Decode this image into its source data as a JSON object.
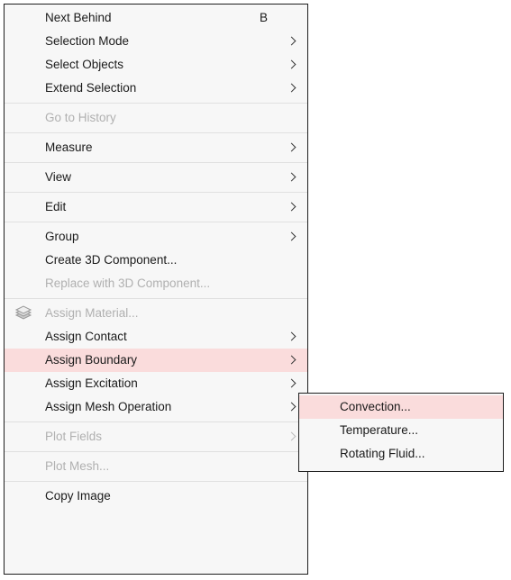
{
  "colors": {
    "menu_background": "#f7f7f7",
    "menu_border": "#1d1d1d",
    "highlight": "#fadcdc",
    "text": "#1a1a1a",
    "text_disabled": "#b0b0b0",
    "separator": "#e0e0e0"
  },
  "main_menu": {
    "items": [
      {
        "label": "Next Behind",
        "shortcut": "B",
        "submenu": false,
        "disabled": false,
        "highlighted": false,
        "icon": null
      },
      {
        "label": "Selection Mode",
        "shortcut": "",
        "submenu": true,
        "disabled": false,
        "highlighted": false,
        "icon": null
      },
      {
        "label": "Select Objects",
        "shortcut": "",
        "submenu": true,
        "disabled": false,
        "highlighted": false,
        "icon": null
      },
      {
        "label": "Extend Selection",
        "shortcut": "",
        "submenu": true,
        "disabled": false,
        "highlighted": false,
        "icon": null
      },
      {
        "separator": true
      },
      {
        "label": "Go to History",
        "shortcut": "",
        "submenu": false,
        "disabled": true,
        "highlighted": false,
        "icon": null
      },
      {
        "separator": true
      },
      {
        "label": "Measure",
        "shortcut": "",
        "submenu": true,
        "disabled": false,
        "highlighted": false,
        "icon": null
      },
      {
        "separator": true
      },
      {
        "label": "View",
        "shortcut": "",
        "submenu": true,
        "disabled": false,
        "highlighted": false,
        "icon": null
      },
      {
        "separator": true
      },
      {
        "label": "Edit",
        "shortcut": "",
        "submenu": true,
        "disabled": false,
        "highlighted": false,
        "icon": null
      },
      {
        "separator": true
      },
      {
        "label": "Group",
        "shortcut": "",
        "submenu": true,
        "disabled": false,
        "highlighted": false,
        "icon": null
      },
      {
        "label": "Create 3D Component...",
        "shortcut": "",
        "submenu": false,
        "disabled": false,
        "highlighted": false,
        "icon": null
      },
      {
        "label": "Replace with 3D Component...",
        "shortcut": "",
        "submenu": false,
        "disabled": true,
        "highlighted": false,
        "icon": null
      },
      {
        "separator": true
      },
      {
        "label": "Assign Material...",
        "shortcut": "",
        "submenu": false,
        "disabled": true,
        "highlighted": false,
        "icon": "material-stack-icon"
      },
      {
        "label": "Assign Contact",
        "shortcut": "",
        "submenu": true,
        "disabled": false,
        "highlighted": false,
        "icon": null
      },
      {
        "label": "Assign Boundary",
        "shortcut": "",
        "submenu": true,
        "disabled": false,
        "highlighted": true,
        "icon": null
      },
      {
        "label": "Assign Excitation",
        "shortcut": "",
        "submenu": true,
        "disabled": false,
        "highlighted": false,
        "icon": null
      },
      {
        "label": "Assign Mesh Operation",
        "shortcut": "",
        "submenu": true,
        "disabled": false,
        "highlighted": false,
        "icon": null
      },
      {
        "separator": true
      },
      {
        "label": "Plot Fields",
        "shortcut": "",
        "submenu": true,
        "disabled": true,
        "highlighted": false,
        "icon": null
      },
      {
        "separator": true
      },
      {
        "label": "Plot Mesh...",
        "shortcut": "",
        "submenu": false,
        "disabled": true,
        "highlighted": false,
        "icon": null
      },
      {
        "separator": true
      },
      {
        "label": "Copy Image",
        "shortcut": "",
        "submenu": false,
        "disabled": false,
        "highlighted": false,
        "icon": null
      }
    ]
  },
  "submenu": {
    "parent": "Assign Boundary",
    "items": [
      {
        "label": "Convection...",
        "submenu": false,
        "disabled": false,
        "highlighted": true
      },
      {
        "label": "Temperature...",
        "submenu": false,
        "disabled": false,
        "highlighted": false
      },
      {
        "label": "Rotating Fluid...",
        "submenu": false,
        "disabled": false,
        "highlighted": false
      }
    ]
  }
}
